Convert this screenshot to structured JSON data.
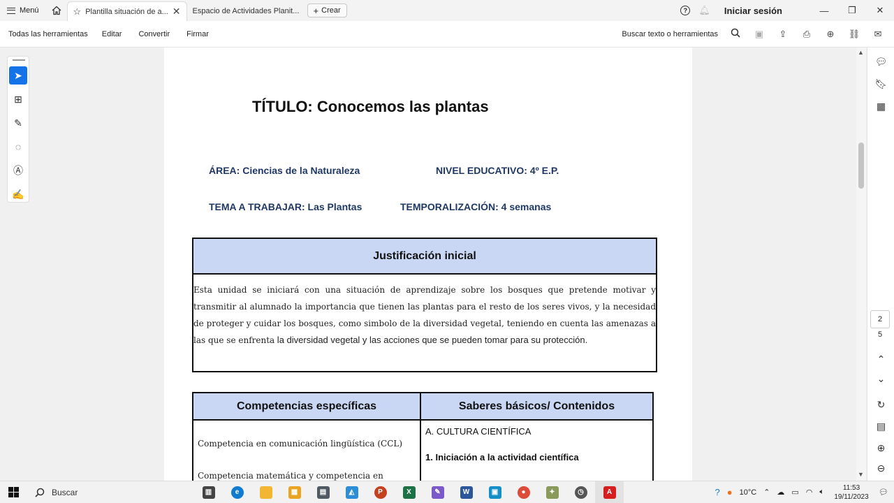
{
  "titlebar": {
    "menu_label": "Menú",
    "tabs": [
      {
        "label": "Plantilla situación de a..."
      },
      {
        "label": "Espacio de Actividades Planit..."
      }
    ],
    "create_label": "Crear",
    "signin_label": "Iniciar sesión"
  },
  "toolbar": {
    "items": [
      "Todas las herramientas",
      "Editar",
      "Convertir",
      "Firmar"
    ],
    "search_label": "Buscar texto o herramientas"
  },
  "document": {
    "title": "TÍTULO: Conocemos las plantas",
    "area": "ÁREA:  Ciencias de la Naturaleza",
    "nivel": "NIVEL EDUCATIVO: 4º E.P.",
    "tema": "TEMA A TRABAJAR: Las Plantas",
    "temporalizacion": "TEMPORALIZACIÓN: 4 semanas",
    "justificacion": {
      "header": "Justificación inicial",
      "text_serif": "Esta unidad se iniciará con una situación de aprendizaje sobre los bosques que pretende motivar y transmitir al alumnado la importancia que tienen las plantas para el resto de los seres vivos, y la necesidad de proteger y cuidar los bosques, como simbolo de la diversidad vegetal, teniendo en cuenta las amenazas a las que se enfrenta",
      "text_sans": " la diversidad vegetal y las acciones que se pueden tomar para su protección."
    },
    "competencias": {
      "col1_header": "Competencias específicas",
      "col2_header": "Saberes básicos/ Contenidos",
      "col1_items": [
        "Competencia en comunicación lingüística (CCL)",
        "Competencia matemática y competencia en"
      ],
      "col2_section": "A. CULTURA CIENTÍFICA",
      "col2_item": "1. Iniciación a la actividad científica"
    }
  },
  "pager": {
    "current": "2",
    "total": "5"
  },
  "taskbar": {
    "search_label": "Buscar",
    "temperature": "10°C",
    "time": "11:53",
    "date": "19/11/2023"
  }
}
